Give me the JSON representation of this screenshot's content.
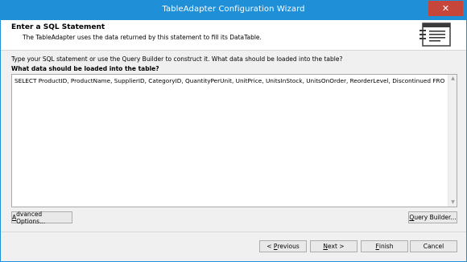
{
  "window": {
    "title": "TableAdapter Configuration Wizard",
    "close_label": "✕"
  },
  "header": {
    "title": "Enter a SQL Statement",
    "subtitle": "The TableAdapter uses the data returned by this statement to fill its DataTable."
  },
  "body": {
    "instruction": "Type your SQL statement or use the Query Builder to construct it. What data should be loaded into the table?",
    "question": "What data should be loaded into the table?",
    "sql": "SELECT ProductID, ProductName, SupplierID, CategoryID, QuantityPerUnit, UnitPrice, UnitsInStock, UnitsOnOrder, ReorderLevel, Discontinued FROM dbo.Products"
  },
  "buttons": {
    "advanced_accel": "A",
    "advanced_rest": "dvanced Options...",
    "query_builder_accel": "Q",
    "query_builder_rest": "uery Builder...",
    "previous_prefix": "< ",
    "previous_accel": "P",
    "previous_rest": "revious",
    "next_accel": "N",
    "next_rest": "ext >",
    "finish_accel": "F",
    "finish_rest": "inish",
    "cancel": "Cancel"
  },
  "colors": {
    "titlebar": "#1f8fd8",
    "close": "#c7463b"
  },
  "icons": {
    "header": "sql-statement-icon",
    "close": "close-icon",
    "scroll_up": "chevron-up-icon",
    "scroll_down": "chevron-down-icon"
  }
}
